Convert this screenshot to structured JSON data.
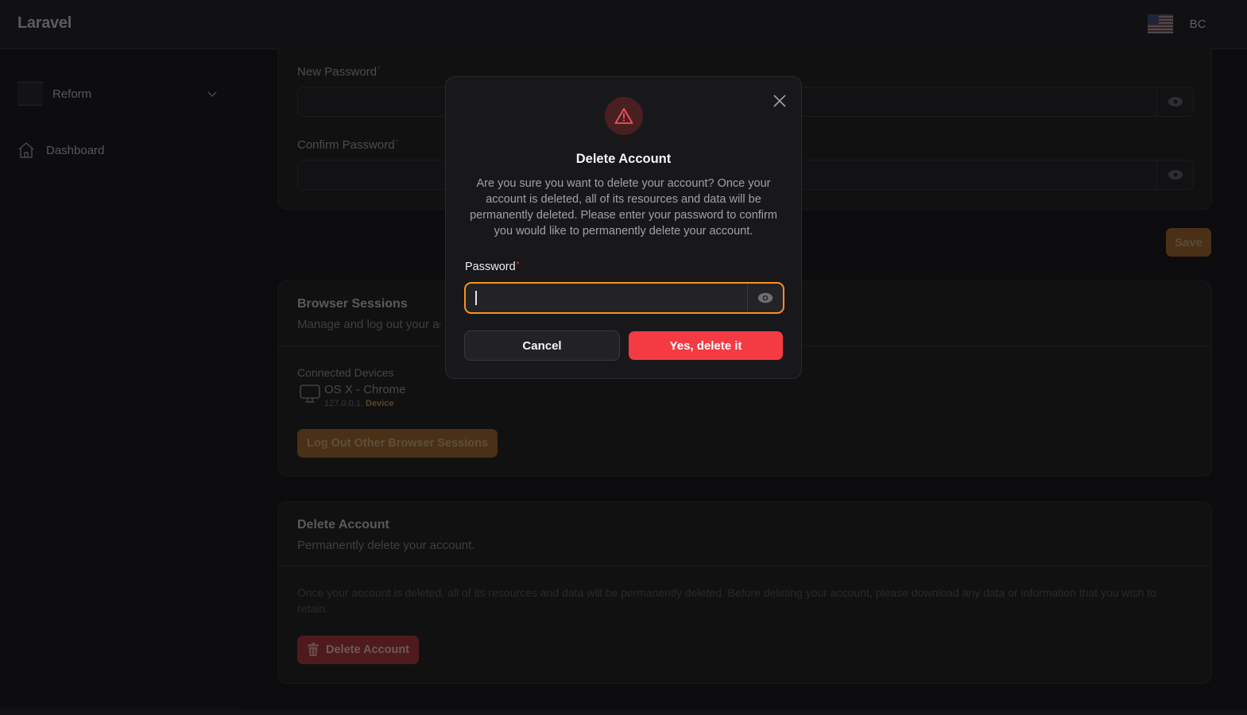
{
  "app": {
    "brand": "Laravel",
    "user_initials": "BC",
    "locale_flag": "us-flag-icon"
  },
  "sidebar": {
    "team": {
      "name": "Reform",
      "icon": "team-logo"
    },
    "items": [
      {
        "label": "Dashboard",
        "icon": "home-icon"
      }
    ]
  },
  "update_password": {
    "new_password_label": "New Password",
    "confirm_password_label": "Confirm Password",
    "new_password_value": "",
    "confirm_password_value": "",
    "save_label": "Save"
  },
  "browser_sessions": {
    "title": "Browser Sessions",
    "subtitle": "Manage and log out your active sessions on other browsers and devices.",
    "connected_devices_label": "Connected Devices",
    "devices": [
      {
        "name": "OS X - Chrome",
        "ip": "127.0.0.1,",
        "status": "Device",
        "icon": "desktop-icon"
      }
    ],
    "logout_label": "Log Out Other Browser Sessions"
  },
  "delete_account": {
    "title": "Delete Account",
    "subtitle": "Permanently delete your account.",
    "description": "Once your account is deleted, all of its resources and data will be permanently deleted. Before deleting your account, please download any data or information that you wish to retain.",
    "button_label": "Delete Account"
  },
  "modal": {
    "title": "Delete Account",
    "description": "Are you sure you want to delete your account? Once your account is deleted, all of its resources and data will be permanently deleted. Please enter your password to confirm you would like to permanently delete your account.",
    "password_label": "Password",
    "required_marker": "*",
    "password_value": "",
    "cancel_label": "Cancel",
    "confirm_label": "Yes, delete it"
  },
  "colors": {
    "accent": "#f59322",
    "danger": "#f43a43",
    "surface": "#18181b",
    "background": "#0c0c0e"
  }
}
